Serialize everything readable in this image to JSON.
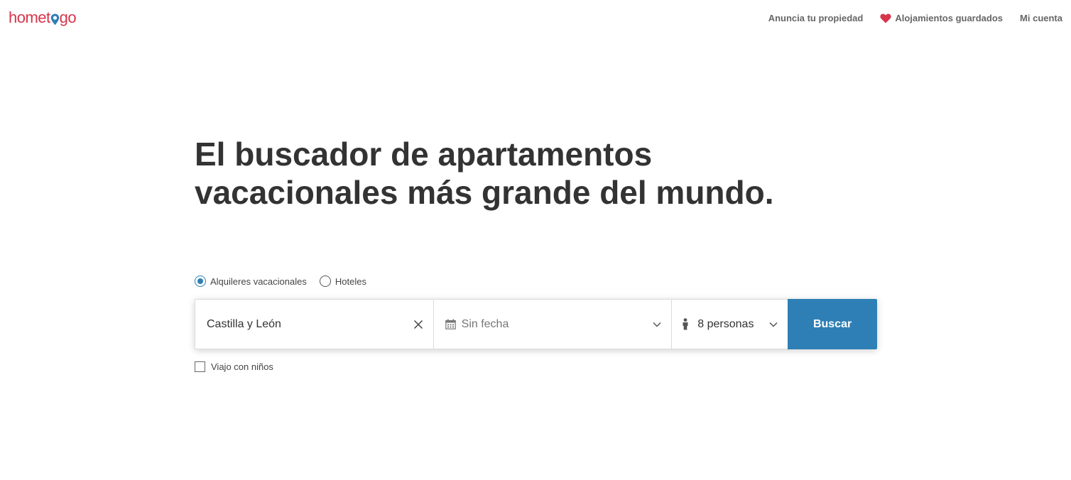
{
  "header": {
    "logo_text_left": "home",
    "logo_text_t": "t",
    "logo_text_right": "go",
    "nav": {
      "list_property": "Anuncia tu propiedad",
      "saved": "Alojamientos guardados",
      "account": "Mi cuenta"
    }
  },
  "hero": {
    "title_line1": "El buscador de apartamentos",
    "title_line2": "vacacionales más grande del mundo."
  },
  "search_type": {
    "options": [
      "Alquileres vacacionales",
      "Hoteles"
    ],
    "selected": "Alquileres vacacionales"
  },
  "search": {
    "destination_value": "Castilla y León",
    "date_value": "Sin fecha",
    "guests_value": "8 personas",
    "button_label": "Buscar"
  },
  "options": {
    "children_label": "Viajo con niños",
    "children_checked": false
  },
  "colors": {
    "brand": "#d6354a",
    "accent": "#2e7fb5",
    "heart": "#d6354a"
  },
  "icons": {
    "clear": "close-icon",
    "calendar": "calendar-icon",
    "chevron": "chevron-down-icon",
    "person": "person-icon",
    "heart": "heart-icon",
    "pin": "map-pin-icon"
  }
}
